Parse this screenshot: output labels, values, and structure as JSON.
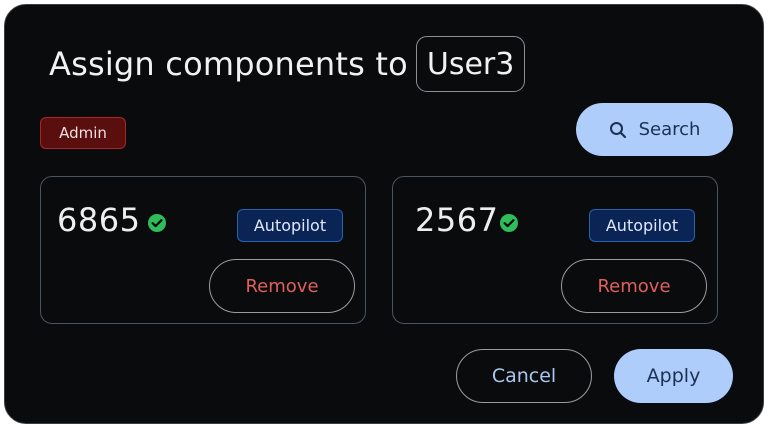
{
  "dialog": {
    "title": "Assign components to",
    "user": "User3",
    "role_badge": "Admin",
    "search_label": "Search"
  },
  "components": [
    {
      "id": "6865",
      "status": "check",
      "mode": "Autopilot",
      "remove_label": "Remove"
    },
    {
      "id": "2567",
      "status": "check",
      "mode": "Autopilot",
      "remove_label": "Remove"
    }
  ],
  "actions": {
    "cancel_label": "Cancel",
    "apply_label": "Apply"
  },
  "colors": {
    "background": "#0a0b0d",
    "primary_button": "#aecdfb",
    "admin_badge": "#5a0e0e",
    "autopilot_badge": "#0b2456",
    "remove_text": "#e0605e",
    "status_ok": "#2ebd59"
  },
  "icons": {
    "search": "search-icon",
    "status": "check-circle-icon"
  }
}
